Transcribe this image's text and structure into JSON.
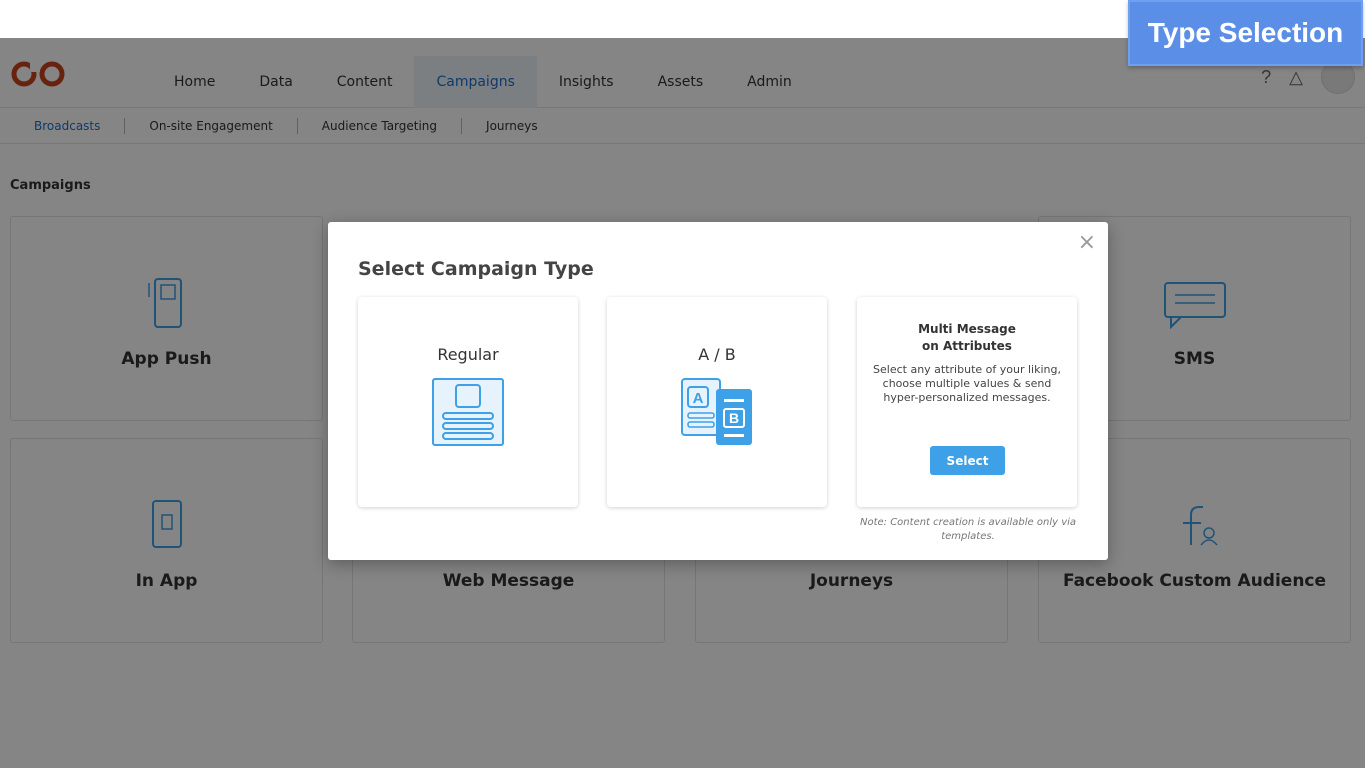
{
  "overlay_label": "Type Selection",
  "nav": {
    "items": [
      "Home",
      "Data",
      "Content",
      "Campaigns",
      "Insights",
      "Assets",
      "Admin"
    ],
    "active": "Campaigns",
    "help_icon": "?",
    "bell_icon": "△"
  },
  "subnav": {
    "items": [
      "Broadcasts",
      "On-site Engagement",
      "Audience Targeting",
      "Journeys"
    ],
    "active": "Broadcasts"
  },
  "page": {
    "title": "Campaigns"
  },
  "tiles": [
    {
      "label": "App Push",
      "icon": "mobile-push-icon"
    },
    {
      "label": "SMS",
      "icon": "sms-icon"
    },
    {
      "label": "In App",
      "icon": "in-app-icon"
    },
    {
      "label": "Web Message",
      "icon": "web-message-icon"
    },
    {
      "label": "Journeys",
      "icon": "journeys-icon"
    },
    {
      "label": "Facebook Custom Audience",
      "icon": "facebook-audience-icon"
    }
  ],
  "modal": {
    "title": "Select Campaign Type",
    "close": "×",
    "cards": {
      "regular": {
        "title": "Regular"
      },
      "ab": {
        "title": "A / B",
        "letter_a": "A",
        "letter_b": "B"
      },
      "multi": {
        "title_line1": "Multi Message",
        "title_line2": "on Attributes",
        "description": "Select any attribute of your liking, choose multiple values & send hyper-personalized messages.",
        "button": "Select"
      }
    },
    "note": "Note: Content creation is available only via templates."
  },
  "colors": {
    "accent": "#3ea0e6",
    "brand": "#c8441e",
    "label_bg": "#5b8ee6",
    "active_nav": "#1d6fc9"
  }
}
